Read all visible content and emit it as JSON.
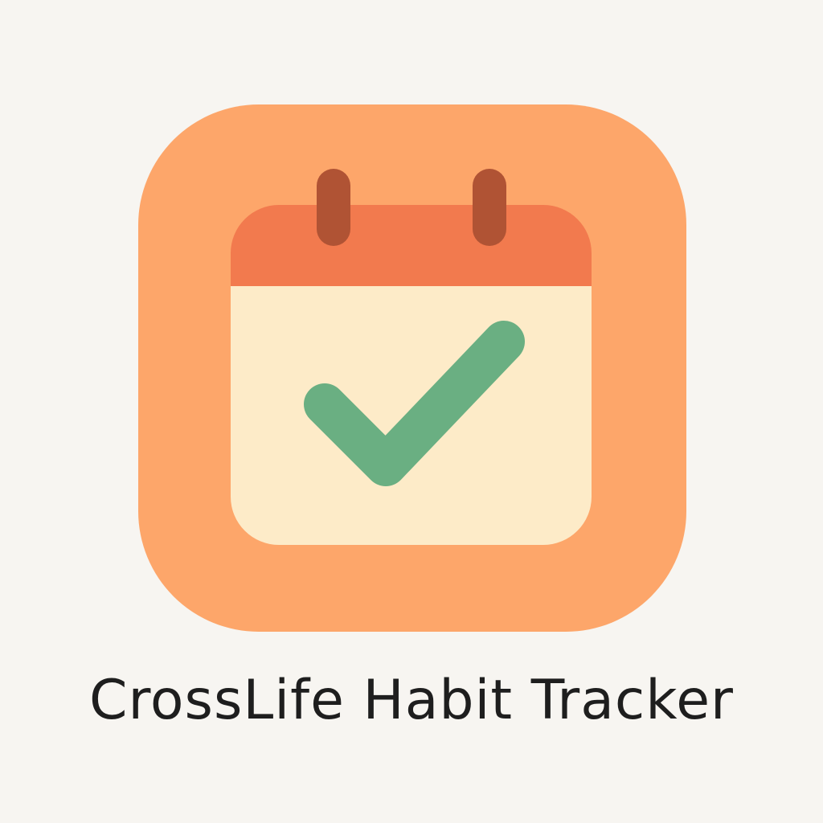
{
  "app": {
    "title": "CrossLife Habit Tracker"
  },
  "icon": {
    "name": "calendar-check-icon"
  },
  "colors": {
    "background": "#f7f5f1",
    "icon_bg": "#fda66a",
    "calendar_header": "#f27a4e",
    "calendar_body": "#fdebc8",
    "rings": "#b05334",
    "check": "#6aaf82",
    "text": "#1e1e1e"
  }
}
